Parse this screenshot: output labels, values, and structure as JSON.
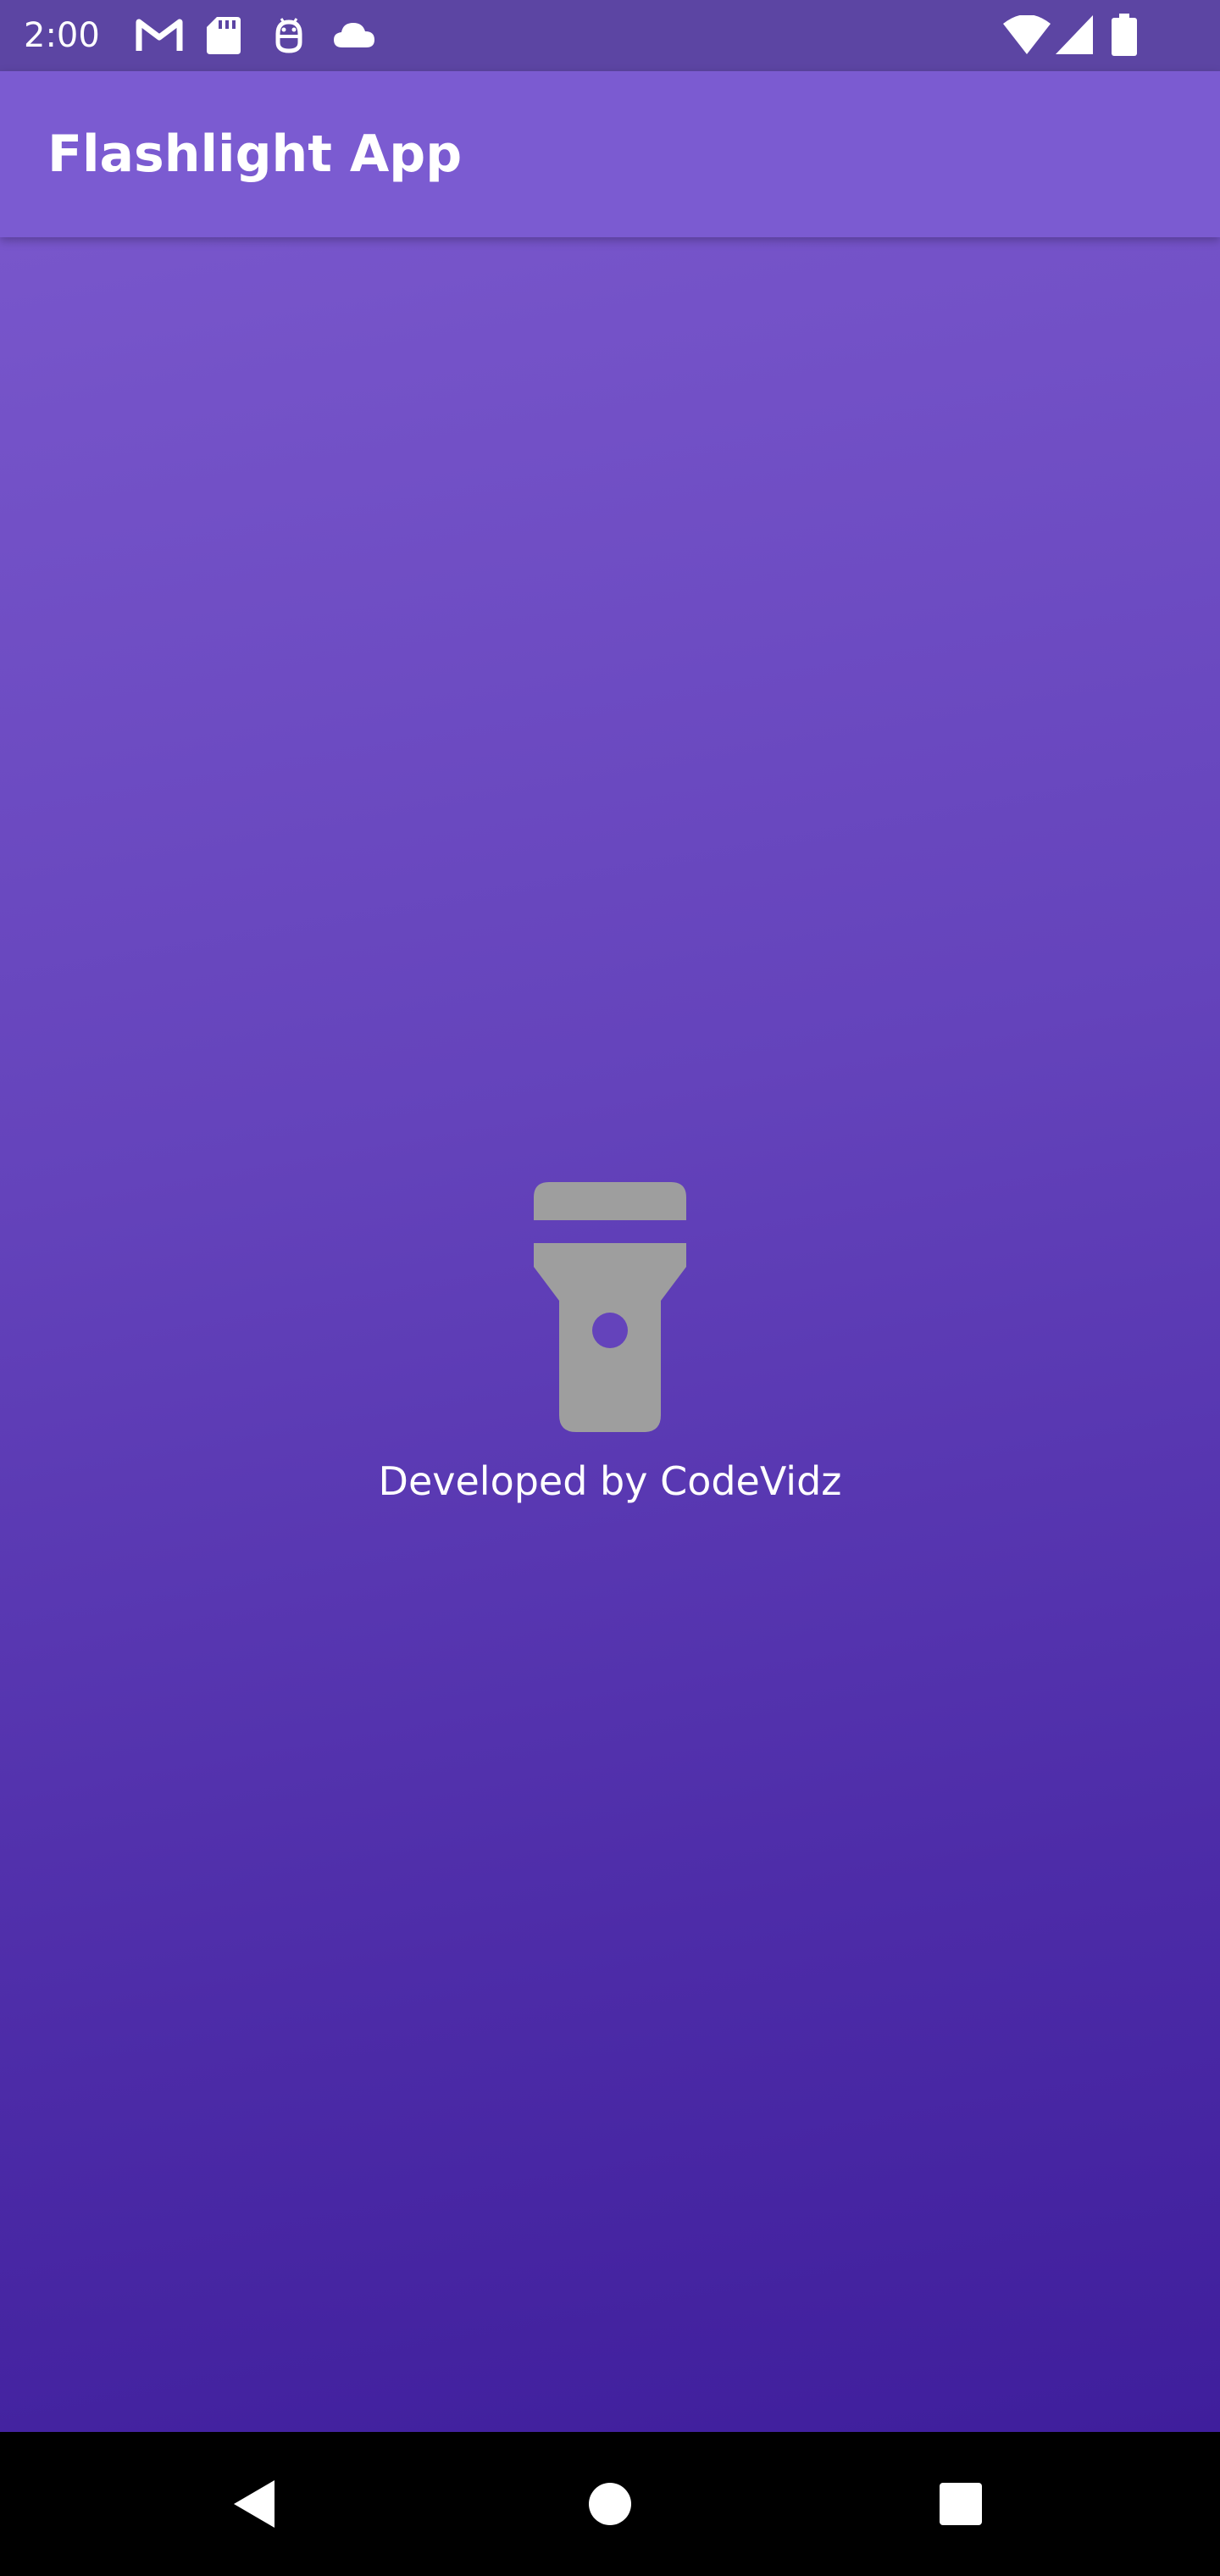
{
  "status_bar": {
    "time": "2:00",
    "left_icons": [
      "gmail-icon",
      "sd-card-icon",
      "android-debug-icon",
      "cloud-icon"
    ],
    "right_icons": [
      "wifi-icon",
      "cell-signal-icon",
      "battery-icon"
    ]
  },
  "app_bar": {
    "title": "Flashlight App"
  },
  "main": {
    "flashlight_icon": "flashlight-icon",
    "flashlight_color": "#9e9e9e",
    "credit_text": "Developed by CodeVidz"
  },
  "nav_bar": {
    "buttons": [
      "back-icon",
      "home-icon",
      "recents-icon"
    ]
  },
  "colors": {
    "status_bar": "#5c45a3",
    "app_bar": "#7b5bd1",
    "gradient_top": "#7856cb",
    "gradient_bottom": "#3f1e9c",
    "nav_bar": "#000000"
  }
}
